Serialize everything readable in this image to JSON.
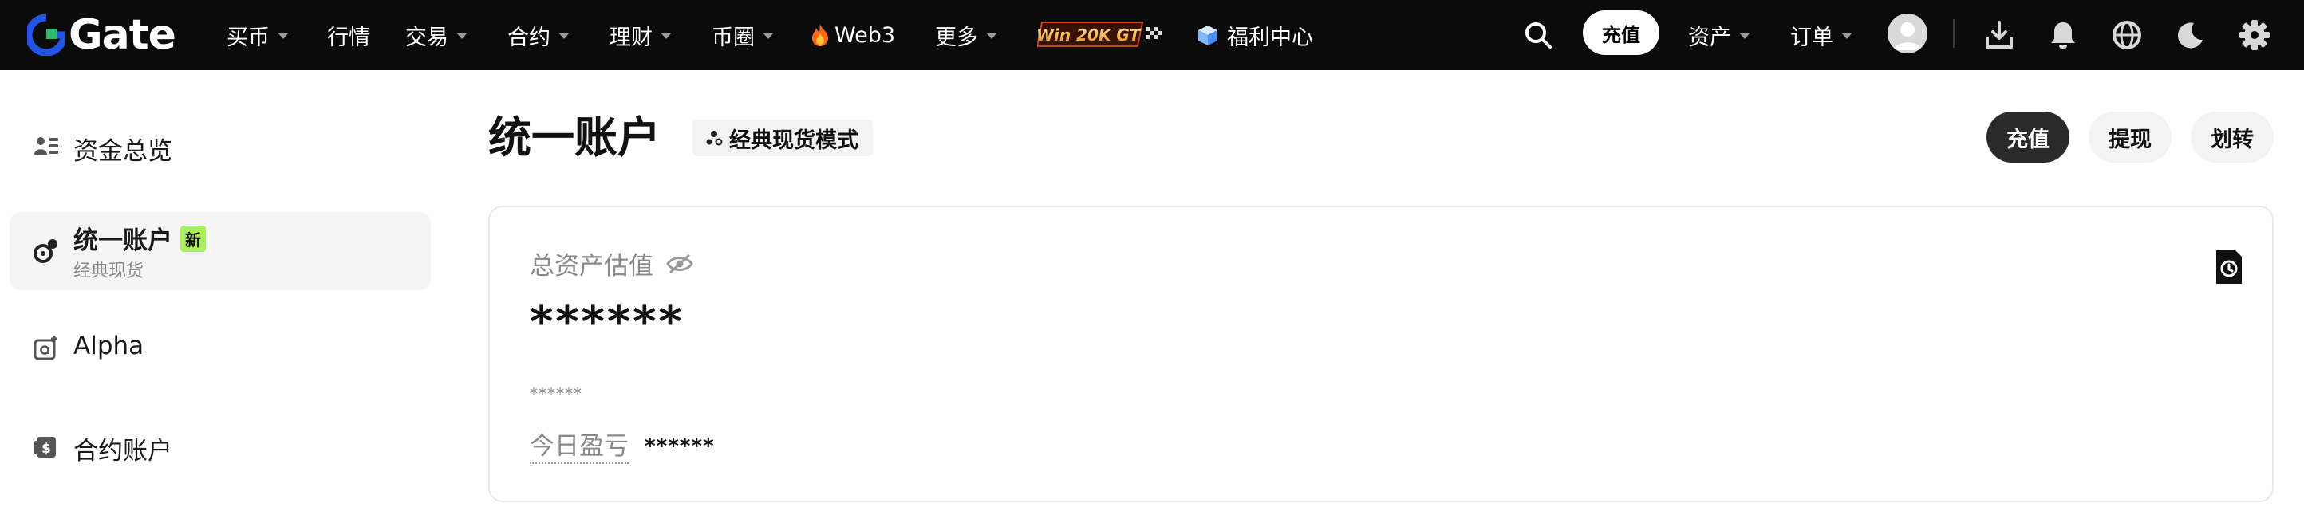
{
  "brand": {
    "name": "Gate"
  },
  "nav": {
    "items": [
      {
        "label": "买币",
        "has_caret": true
      },
      {
        "label": "行情",
        "has_caret": false
      },
      {
        "label": "交易",
        "has_caret": true
      },
      {
        "label": "合约",
        "has_caret": true
      },
      {
        "label": "理财",
        "has_caret": true
      },
      {
        "label": "币圈",
        "has_caret": true
      },
      {
        "label": "Web3",
        "has_caret": false,
        "icon": "fire-icon"
      },
      {
        "label": "更多",
        "has_caret": true
      }
    ],
    "promo_text": "Win 20K GT",
    "rewards_label": "福利中心",
    "deposit_label": "充值",
    "assets_label": "资产",
    "orders_label": "订单"
  },
  "sidebar": {
    "items": [
      {
        "label": "资金总览",
        "icon": "wallet-overview-icon"
      },
      {
        "label": "统一账户",
        "badge": "新",
        "sub": "经典现货",
        "icon": "unified-account-icon",
        "active": true
      },
      {
        "label": "Alpha",
        "icon": "alpha-icon"
      },
      {
        "label": "合约账户",
        "icon": "futures-account-icon"
      }
    ]
  },
  "main": {
    "title": "统一账户",
    "mode_chip": "经典现货模式",
    "actions": {
      "deposit": "充值",
      "withdraw": "提现",
      "transfer": "划转"
    },
    "card": {
      "total_label": "总资产估值",
      "total_value": "******",
      "total_sub": "******",
      "pnl_label": "今日盈亏",
      "pnl_value": "******"
    }
  },
  "colors": {
    "nav_bg": "#0b0b0b",
    "brand_blue": "#2354e6",
    "new_badge": "#a8f05a",
    "button_dark": "#2a2a2a"
  }
}
